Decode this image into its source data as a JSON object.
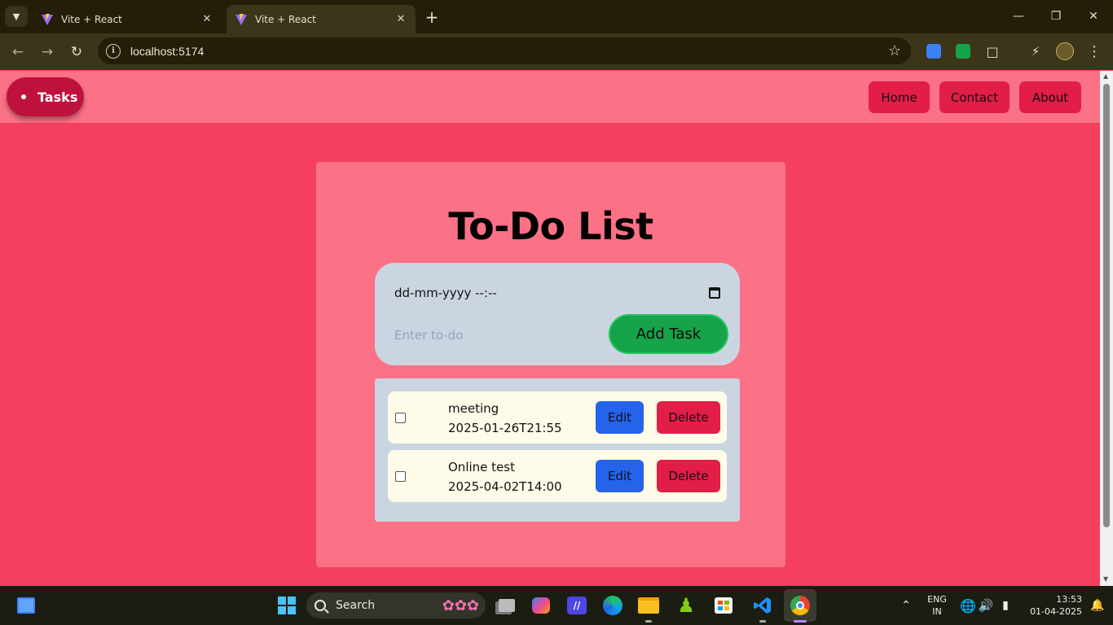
{
  "browser": {
    "tabs": [
      {
        "title": "Vite + React",
        "active": false
      },
      {
        "title": "Vite + React",
        "active": true
      }
    ],
    "url": "localhost:5174"
  },
  "navbar": {
    "brand": "Tasks",
    "links": [
      "Home",
      "Contact",
      "About"
    ]
  },
  "todo": {
    "heading": "To-Do List",
    "date_value": "dd-mm-yyyy --:--",
    "input_placeholder": "Enter to-do",
    "add_label": "Add Task",
    "tasks": [
      {
        "name": "meeting",
        "datetime": "2025-01-26T21:55",
        "done": false,
        "edit_label": "Edit",
        "delete_label": "Delete"
      },
      {
        "name": "Online test",
        "datetime": "2025-04-02T14:00",
        "done": false,
        "edit_label": "Edit",
        "delete_label": "Delete"
      }
    ]
  },
  "taskbar": {
    "search_label": "Search",
    "lang": "ENG",
    "region": "IN",
    "time": "13:53",
    "date": "01-04-2025"
  },
  "colors": {
    "page_bg": "#f43f5e",
    "card_bg": "#fb7185",
    "panel_bg": "#cbd5e1",
    "task_bg": "#fefce8",
    "add_button": "#16a34a",
    "edit_button": "#2563eb",
    "delete_button": "#e11d48",
    "brand_pill": "#be123c"
  }
}
